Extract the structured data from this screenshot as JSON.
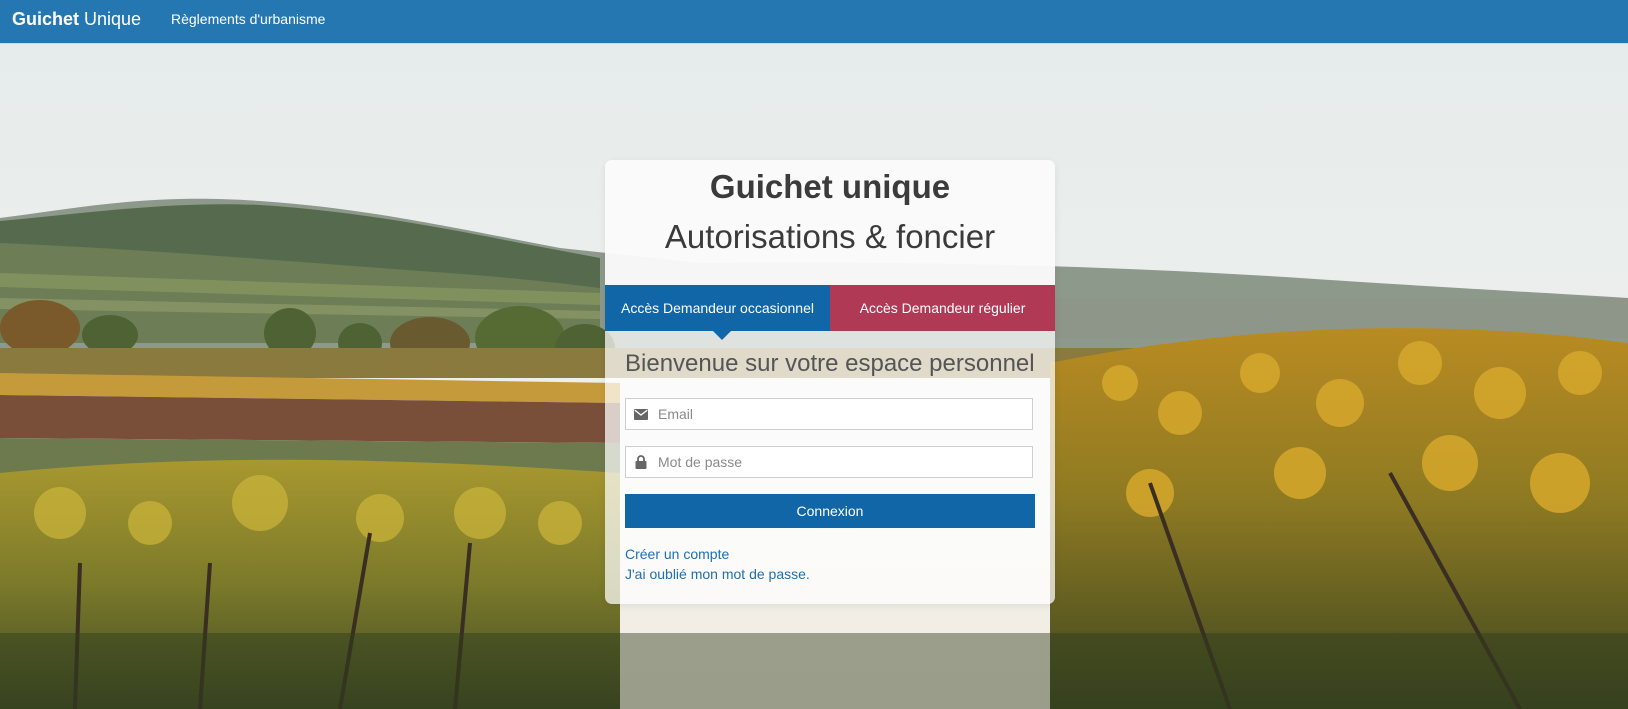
{
  "navbar": {
    "brand_bold": "Guichet",
    "brand_rest": "Unique",
    "link": "Règlements d'urbanisme",
    "color": "#2577b1"
  },
  "card": {
    "title": "Guichet unique",
    "subtitle": "Autorisations & foncier",
    "tabs": [
      {
        "label": "Accès Demandeur occasionnel",
        "color": "#1166a8",
        "active": true
      },
      {
        "label": "Accès Demandeur régulier",
        "color": "#b03a55",
        "active": false
      }
    ],
    "welcome": "Bienvenue sur votre espace personnel",
    "email_placeholder": "Email",
    "email_icon": "envelope-icon",
    "password_placeholder": "Mot de passe",
    "password_icon": "lock-icon",
    "login_button": "Connexion",
    "create_account_link": "Créer un compte",
    "forgot_password_link": "J'ai oublié mon mot de passe."
  }
}
